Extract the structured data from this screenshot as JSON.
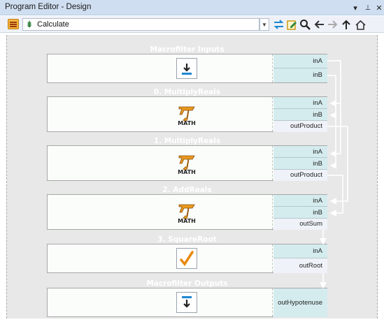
{
  "window": {
    "title": "Program Editor - Design"
  },
  "titlebar_buttons": {
    "dropdown": "▾",
    "pin": "⊥",
    "close": "✕"
  },
  "toolbar": {
    "menu_icon": "hamburger-menu-icon",
    "combo_value": "Calculate",
    "combo_icon": "tree-icon",
    "tools": [
      "swap-icon",
      "edit-icon",
      "search-icon",
      "arrow-left-icon",
      "arrow-right-icon",
      "arrow-up-icon",
      "home-icon"
    ]
  },
  "blocks": [
    {
      "title": "Macrofilter Inputs",
      "icon": "download-arrow-icon",
      "ports": [
        "inA",
        "inB"
      ]
    },
    {
      "title": "0. MultiplyReals",
      "icon": "math-icon",
      "ports": [
        "inA",
        "inB",
        "outProduct"
      ]
    },
    {
      "title": "1. MultiplyReals",
      "icon": "math-icon",
      "ports": [
        "inA",
        "inB",
        "outProduct"
      ]
    },
    {
      "title": "2. AddReals",
      "icon": "math-icon",
      "ports": [
        "inA",
        "inB",
        "outSum"
      ]
    },
    {
      "title": "3. SquareRoot",
      "icon": "sqrt-icon",
      "ports": [
        "inA",
        "outRoot"
      ]
    },
    {
      "title": "Macrofilter Outputs",
      "icon": "output-arrow-icon",
      "ports": [
        "outHypotenuse"
      ]
    }
  ],
  "math_label": "MATH",
  "colors": {
    "port_in": "#d5ecef",
    "port_out": "#eff2f8",
    "canvas": "#e8e8e8",
    "wire": "#ffffff",
    "accent": "#1f86d3"
  }
}
